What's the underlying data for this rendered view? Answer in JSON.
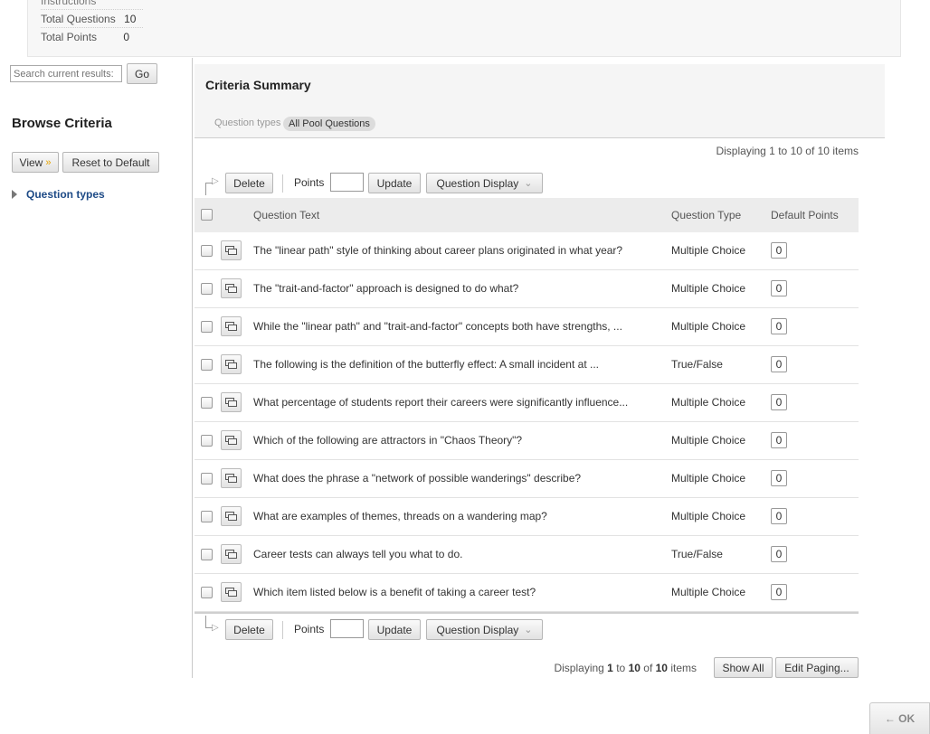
{
  "info": {
    "instructions_label": "Instructions",
    "total_questions_label": "Total Questions",
    "total_questions_value": "10",
    "total_points_label": "Total Points",
    "total_points_value": "0"
  },
  "sidebar": {
    "search_placeholder": "Search current results:",
    "go_label": "Go",
    "browse_title": "Browse Criteria",
    "view_label": "View",
    "reset_label": "Reset to Default",
    "tree_item": "Question types"
  },
  "summary": {
    "title": "Criteria Summary",
    "question_types_label": "Question types",
    "question_types_chip": "All Pool Questions"
  },
  "paging": {
    "displaying_prefix": "Displaying",
    "start": "1",
    "to": "to",
    "end": "10",
    "of": "of",
    "total": "10",
    "items": "items",
    "show_all": "Show All",
    "edit_paging": "Edit Paging..."
  },
  "actions": {
    "delete_label": "Delete",
    "points_label": "Points",
    "update_label": "Update",
    "question_display_label": "Question Display"
  },
  "table": {
    "headers": [
      "Question Text",
      "Question Type",
      "Default Points"
    ],
    "rows": [
      {
        "text": "The \"linear path\" style of thinking about career plans originated in what year?",
        "type": "Multiple Choice",
        "points": "0"
      },
      {
        "text": "The \"trait-and-factor\" approach is designed to do what?",
        "type": "Multiple Choice",
        "points": "0"
      },
      {
        "text": "While the \"linear path\" and \"trait-and-factor\" concepts both have strengths, ...",
        "type": "Multiple Choice",
        "points": "0"
      },
      {
        "text": "The following is the definition of the butterfly effect: A small incident at ...",
        "type": "True/False",
        "points": "0"
      },
      {
        "text": "What percentage of students report their careers were significantly influence...",
        "type": "Multiple Choice",
        "points": "0"
      },
      {
        "text": "Which of the following are attractors in \"Chaos Theory\"?",
        "type": "Multiple Choice",
        "points": "0"
      },
      {
        "text": "What does the phrase a \"network of possible wanderings\" describe?",
        "type": "Multiple Choice",
        "points": "0"
      },
      {
        "text": "What are examples of themes, threads on a wandering map?",
        "type": "Multiple Choice",
        "points": "0"
      },
      {
        "text": "Career tests can always tell you what to do.",
        "type": "True/False",
        "points": "0"
      },
      {
        "text": "Which item listed below is a benefit of taking a career test?",
        "type": "Multiple Choice",
        "points": "0"
      }
    ]
  },
  "footer": {
    "ok_label": "← OK"
  }
}
